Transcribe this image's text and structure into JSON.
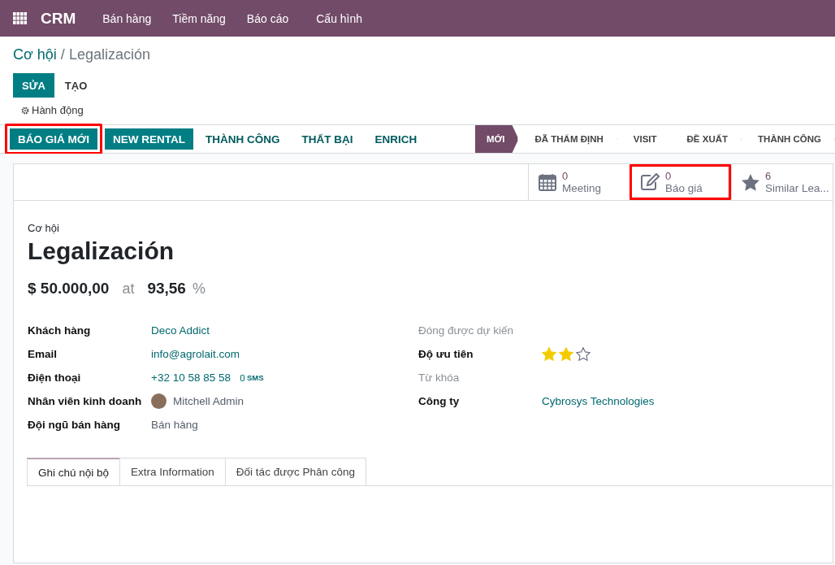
{
  "navbar": {
    "app": "CRM",
    "menus": [
      "Bán hàng",
      "Tiềm năng",
      "Báo cáo",
      "Cấu hình"
    ]
  },
  "breadcrumb": {
    "parent": "Cơ hội",
    "separator": "/",
    "current": "Legalización"
  },
  "control_buttons": [
    {
      "label": "SỬA",
      "kind": "primary"
    },
    {
      "label": "TẠO",
      "kind": "plain"
    }
  ],
  "action_menu": "Hành động",
  "header_buttons": [
    {
      "label": "BÁO GIÁ MỚI",
      "kind": "primary",
      "highlighted": true
    },
    {
      "label": "NEW RENTAL",
      "kind": "primary",
      "highlighted": false
    },
    {
      "label": "THÀNH CÔNG",
      "kind": "plain",
      "highlighted": false
    },
    {
      "label": "THẤT BẠI",
      "kind": "plain",
      "highlighted": false
    },
    {
      "label": "ENRICH",
      "kind": "plain",
      "highlighted": false
    }
  ],
  "stages": [
    {
      "label": "MỚI",
      "selected": true
    },
    {
      "label": "ĐÃ THẨM ĐỊNH",
      "selected": false
    },
    {
      "label": "VISIT",
      "selected": false
    },
    {
      "label": "ĐỀ XUẤT",
      "selected": false
    },
    {
      "label": "THÀNH CÔNG",
      "selected": false
    }
  ],
  "smart_buttons": [
    {
      "kind": "calendar",
      "count": "0",
      "label": "Meeting",
      "highlighted": false
    },
    {
      "kind": "edit",
      "count": "0",
      "label": "Báo giá",
      "highlighted": true
    },
    {
      "kind": "star",
      "count": "6",
      "label": "Similar Lea...",
      "highlighted": false
    }
  ],
  "form": {
    "record_type": "Cơ hội",
    "title": "Legalización",
    "revenue": "$ 50.000,00",
    "at": "at",
    "probability": "93,56",
    "percent": "%",
    "left_fields": [
      {
        "label": "Khách hàng",
        "value": "Deco Addict",
        "kind": "link"
      },
      {
        "label": "Email",
        "value": "info@agrolait.com",
        "kind": "link"
      },
      {
        "label": "Điện thoại",
        "value": "+32 10 58 85 58",
        "sms": "SMS",
        "kind": "phone"
      },
      {
        "label": "Nhân viên kinh doanh",
        "value": "Mitchell Admin",
        "kind": "user"
      },
      {
        "label": "Đội ngũ bán hàng",
        "value": "Bán hàng",
        "kind": "text"
      }
    ],
    "right_fields": [
      {
        "label": "Đóng được dự kiến",
        "kind": "empty"
      },
      {
        "label": "Độ ưu tiên",
        "kind": "stars",
        "stars": 2
      },
      {
        "label": "Từ khóa",
        "kind": "empty"
      },
      {
        "label": "Công ty",
        "value": "Cybrosys Technologies",
        "kind": "link"
      }
    ],
    "tabs": [
      {
        "label": "Ghi chú nội bộ",
        "selected": true
      },
      {
        "label": "Extra Information",
        "selected": false
      },
      {
        "label": "Đối tác được Phân công",
        "selected": false
      }
    ]
  }
}
